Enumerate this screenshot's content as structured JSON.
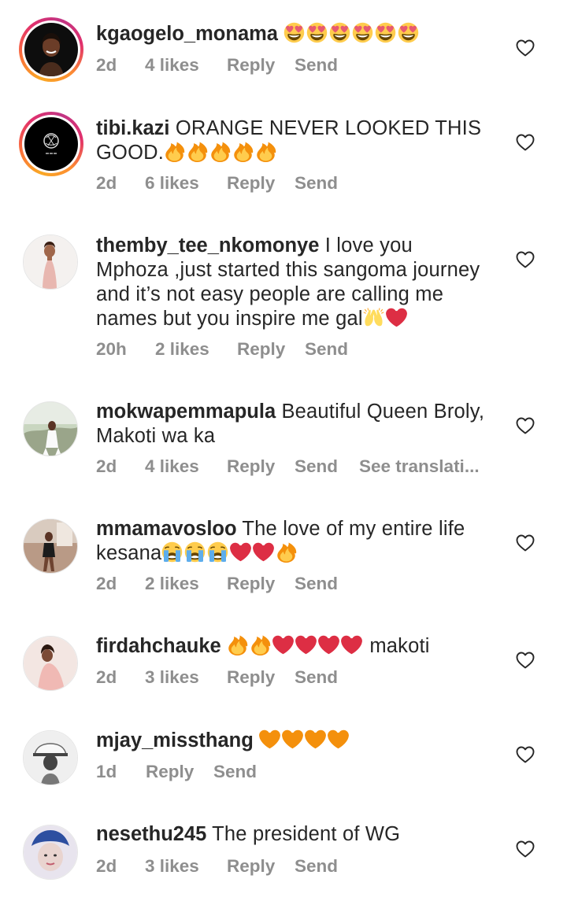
{
  "comments": [
    {
      "username": "kgaogelo_monama",
      "text": "",
      "emoji_after_text": [
        "heart-eyes",
        "heart-eyes",
        "heart-eyes",
        "heart-eyes",
        "heart-eyes",
        "heart-eyes"
      ],
      "time": "2d",
      "likes": "4 likes",
      "reply": "Reply",
      "send": "Send",
      "story_ring": true
    },
    {
      "username": "tibi.kazi",
      "text": "ORANGE NEVER LOOKED THIS GOOD.",
      "emoji_after_text": [
        "fire",
        "fire",
        "fire",
        "fire",
        "fire"
      ],
      "time": "2d",
      "likes": "6 likes",
      "reply": "Reply",
      "send": "Send",
      "story_ring": true
    },
    {
      "username": "themby_tee_nkomonye",
      "text": "I love you Mphoza ,just started this sangoma journey and it’s not easy people are calling me names but you inspire me gal",
      "emoji_after_text": [
        "raising-hands",
        "red-heart"
      ],
      "time": "20h",
      "likes": "2 likes",
      "reply": "Reply",
      "send": "Send",
      "story_ring": false
    },
    {
      "username": "mokwapemmapula",
      "text": "Beautiful Queen Broly, Makoti wa ka",
      "emoji_after_text": [],
      "time": "2d",
      "likes": "4 likes",
      "reply": "Reply",
      "send": "Send",
      "translation": "See translati...",
      "story_ring": false
    },
    {
      "username": "mmamavosloo",
      "text": "The love of my entire life kesana",
      "emoji_after_text": [
        "crying",
        "crying",
        "crying",
        "red-heart",
        "red-heart",
        "fire"
      ],
      "time": "2d",
      "likes": "2 likes",
      "reply": "Reply",
      "send": "Send",
      "story_ring": false
    },
    {
      "username": "firdahchauke",
      "text": "makoti",
      "emoji_before_text": [
        "fire",
        "fire",
        "red-heart",
        "red-heart",
        "red-heart",
        "red-heart"
      ],
      "time": "2d",
      "likes": "3 likes",
      "reply": "Reply",
      "send": "Send",
      "story_ring": false
    },
    {
      "username": "mjay_missthang",
      "text": "",
      "emoji_after_text": [
        "orange-heart",
        "orange-heart",
        "orange-heart",
        "orange-heart"
      ],
      "time": "1d",
      "likes": "",
      "reply": "Reply",
      "send": "Send",
      "story_ring": false
    },
    {
      "username": "nesethu245",
      "text": "The president of WG",
      "emoji_after_text": [],
      "time": "2d",
      "likes": "3 likes",
      "reply": "Reply",
      "send": "Send",
      "story_ring": false
    }
  ],
  "icons": {
    "like": "heart-outline-icon"
  },
  "colors": {
    "text": "#262626",
    "meta": "#8e8e8e",
    "story_ring_start": "#f9a825",
    "story_ring_end": "#c13584"
  }
}
